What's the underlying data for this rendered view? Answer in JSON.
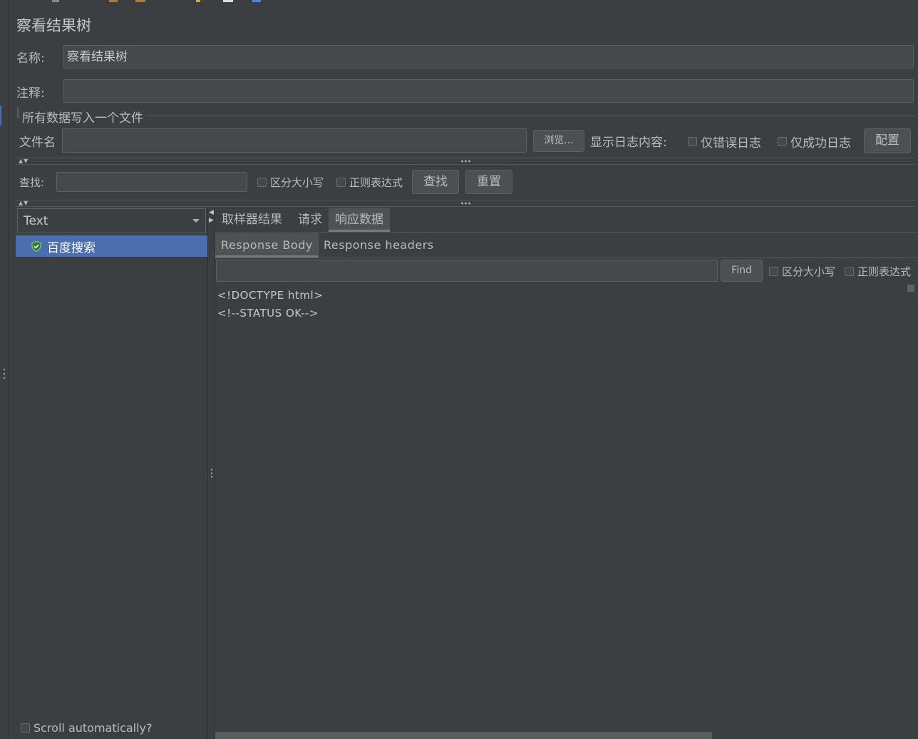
{
  "panel": {
    "title": "察看结果树"
  },
  "name_row": {
    "label": "名称:",
    "value": "察看结果树"
  },
  "comment_row": {
    "label": "注释:",
    "value": ""
  },
  "file_section": {
    "legend": "所有数据写入一个文件",
    "filename_label": "文件名",
    "filename_value": "",
    "browse_label": "浏览...",
    "log_label": "显示日志内容:",
    "errors_only_label": "仅错误日志",
    "success_only_label": "仅成功日志",
    "configure_label": "配置"
  },
  "search_row": {
    "label": "查找:",
    "value": "",
    "case_label": "区分大小写",
    "regex_label": "正则表达式",
    "find_label": "查找",
    "reset_label": "重置"
  },
  "renderer": {
    "selected": "Text"
  },
  "tree": {
    "items": [
      {
        "label": "百度搜索",
        "status": "success"
      }
    ]
  },
  "scroll_auto": {
    "label": "Scroll automatically?"
  },
  "result_tabs": [
    {
      "label": "取样器结果",
      "active": false
    },
    {
      "label": "请求",
      "active": false
    },
    {
      "label": "响应数据",
      "active": true
    }
  ],
  "response_tabs": [
    {
      "label": "Response Body",
      "active": true
    },
    {
      "label": "Response headers",
      "active": false
    }
  ],
  "response_search": {
    "value": "",
    "find_label": "Find",
    "case_label": "区分大小写",
    "regex_label": "正则表达式"
  },
  "response_body": {
    "lines": [
      "<!DOCTYPE html>",
      "<!--STATUS OK-->"
    ]
  },
  "colors": {
    "background": "#3c3f41",
    "field_background": "#45494a",
    "selection": "#4b6eaf",
    "text": "#bbbbbb",
    "success_icon": "#3fae3f"
  }
}
